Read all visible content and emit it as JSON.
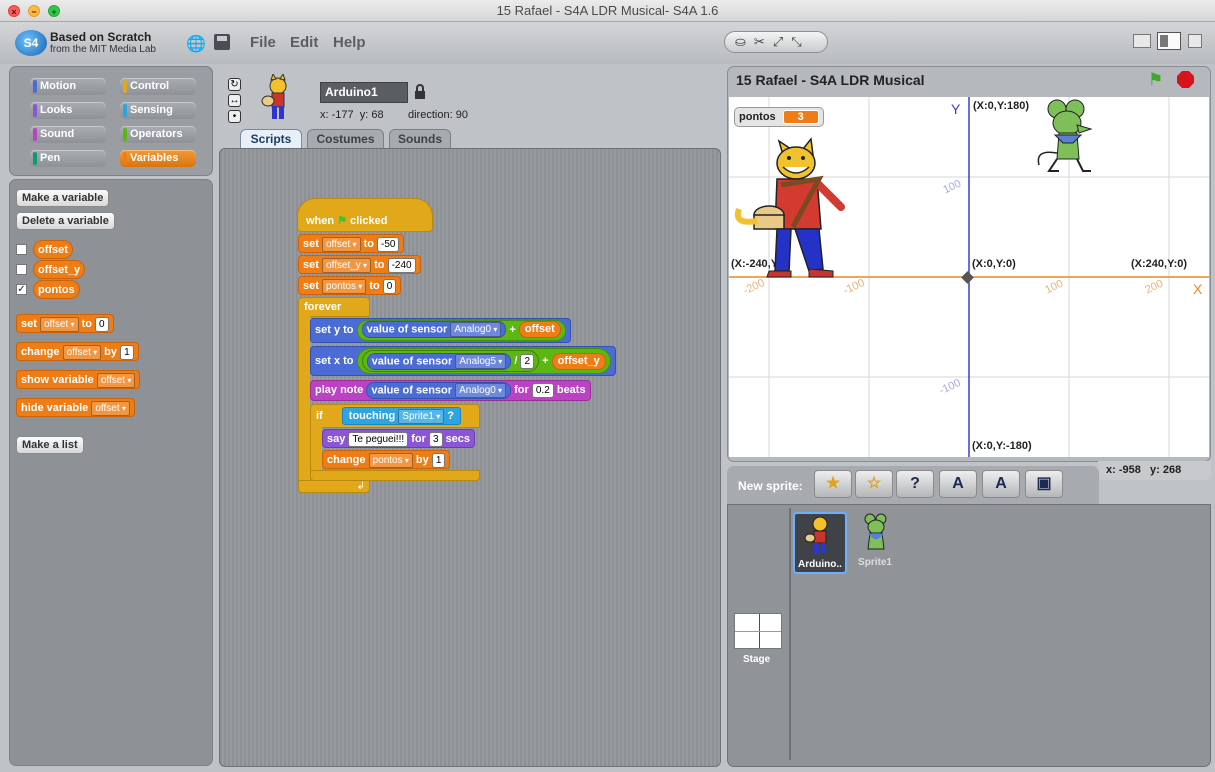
{
  "window": {
    "title": "15 Rafael - S4A LDR Musical- S4A 1.6"
  },
  "logo": {
    "line1": "Based on Scratch",
    "line2": "from the MIT Media Lab",
    "badge": "S4"
  },
  "menu": {
    "file": "File",
    "edit": "Edit",
    "help": "Help"
  },
  "categories": [
    {
      "label": "Motion",
      "color": "#4a6cd4"
    },
    {
      "label": "Control",
      "color": "#e1a91a"
    },
    {
      "label": "Looks",
      "color": "#8a55d7"
    },
    {
      "label": "Sensing",
      "color": "#2ca5e2"
    },
    {
      "label": "Sound",
      "color": "#bb42c3"
    },
    {
      "label": "Operators",
      "color": "#5cb712"
    },
    {
      "label": "Pen",
      "color": "#0e9a6c"
    },
    {
      "label": "Variables",
      "color": "#ee7d16"
    }
  ],
  "palette": {
    "make_variable": "Make a variable",
    "delete_variable": "Delete a variable",
    "variables": [
      {
        "name": "offset",
        "checked": false
      },
      {
        "name": "offset_y",
        "checked": false
      },
      {
        "name": "pontos",
        "checked": true
      }
    ],
    "check_mark": "✓",
    "set_block": {
      "set": "set",
      "var": "offset",
      "to": "to",
      "value": "0"
    },
    "change_block": {
      "change": "change",
      "var": "offset",
      "by": "by",
      "value": "1"
    },
    "show_block": {
      "label": "show variable",
      "var": "offset"
    },
    "hide_block": {
      "label": "hide variable",
      "var": "offset"
    },
    "make_list": "Make a list"
  },
  "sprite": {
    "name": "Arduino1",
    "x_label": "x:",
    "x": "-177",
    "y_label": "y:",
    "y": "68",
    "direction_label": "direction:",
    "direction": "90"
  },
  "tabs": [
    "Scripts",
    "Costumes",
    "Sounds"
  ],
  "script": {
    "when": "when",
    "clicked": "clicked",
    "set1": {
      "set": "set",
      "var": "offset",
      "to": "to",
      "value": "-50"
    },
    "set2": {
      "set": "set",
      "var": "offset_y",
      "to": "to",
      "value": "-240"
    },
    "set3": {
      "set": "set",
      "var": "pontos",
      "to": "to",
      "value": "0"
    },
    "forever": "forever",
    "sety": {
      "label": "set y to",
      "sensor": "value of sensor",
      "port": "Analog0",
      "plus": "+",
      "var": "offset"
    },
    "setx": {
      "label": "set x to",
      "sensor": "value of sensor",
      "port": "Analog5",
      "div": "/",
      "divisor": "2",
      "plus": "+",
      "var": "offset_y"
    },
    "note": {
      "label": "play note",
      "sensor": "value of sensor",
      "port": "Analog0",
      "for": "for",
      "beats_value": "0.2",
      "beats": "beats"
    },
    "if": {
      "label": "if",
      "touching": "touching",
      "target": "Sprite1",
      "q": "?"
    },
    "say": {
      "say": "say",
      "text": "Te peguei!!!",
      "for": "for",
      "secs_value": "3",
      "secs": "secs"
    },
    "change": {
      "label": "change",
      "var": "pontos",
      "by": "by",
      "value": "1"
    },
    "loop_arrow": "↲"
  },
  "stage": {
    "title": "15 Rafael - S4A LDR Musical",
    "monitor": {
      "name": "pontos",
      "value": "3"
    },
    "axis": {
      "x": "X",
      "y": "Y"
    },
    "coords": {
      "top": "(X:0,Y:180)",
      "left": "(X:-240,Y:0)",
      "center": "(X:0,Y:0)",
      "right": "(X:240,Y:0)",
      "bottom": "(X:0,Y:-180)"
    },
    "ticks": {
      "x_neg200": "-200",
      "x_neg100": "-100",
      "x_100": "100",
      "x_200": "200",
      "y_100": "100",
      "y_neg100": "-100"
    }
  },
  "mouse": {
    "x_label": "x:",
    "x": "-958",
    "y_label": "y:",
    "y": "268"
  },
  "new_sprite": {
    "label": "New sprite:"
  },
  "sprites": [
    {
      "name": "Arduino..",
      "selected": true
    },
    {
      "name": "Sprite1",
      "selected": false
    }
  ],
  "stage_thumb": "Stage",
  "colors": {
    "variables": "#ee7d16",
    "control": "#e1a91a",
    "motion": "#4a6cd4",
    "sound": "#bb42c3",
    "sensing": "#2ca5e2",
    "operators": "#5cb712",
    "looks": "#8a55d7"
  }
}
